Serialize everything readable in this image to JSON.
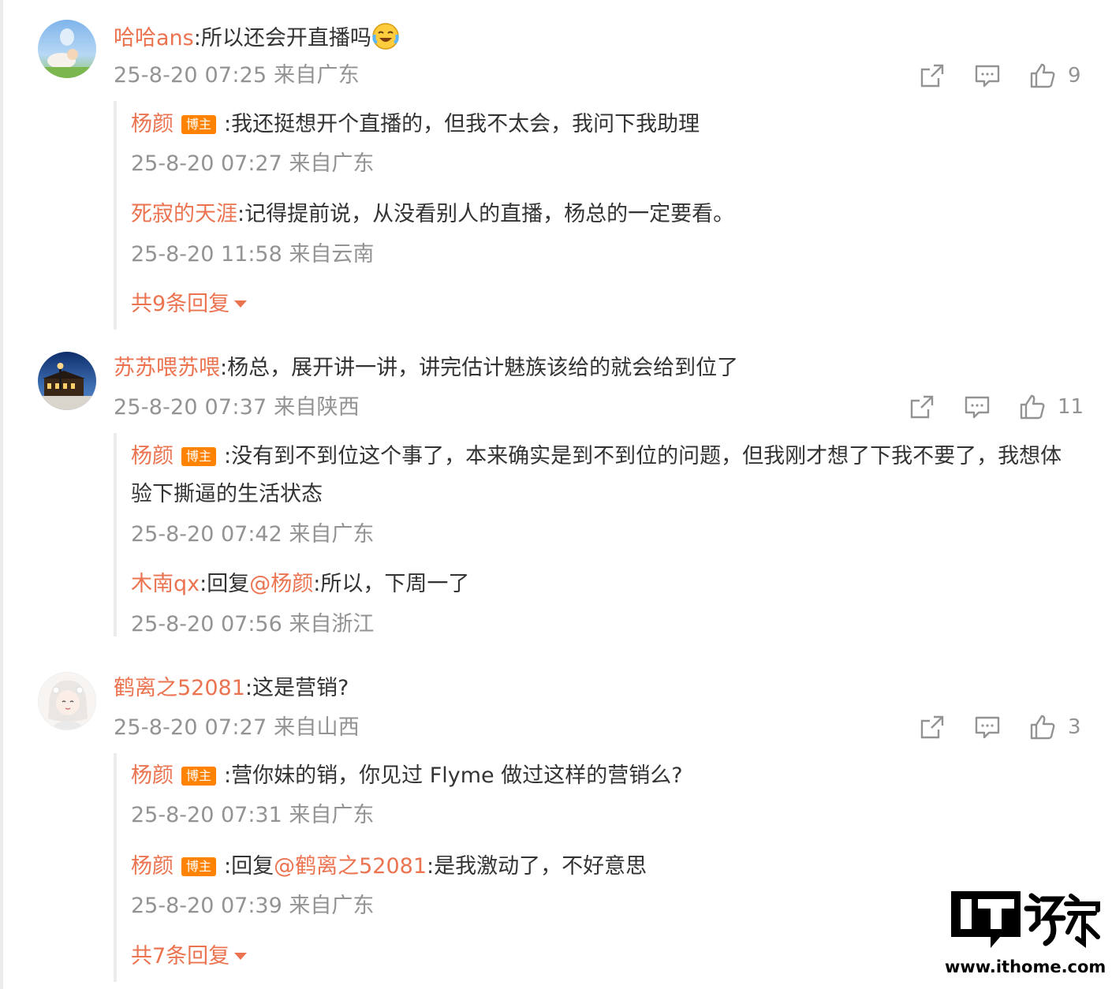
{
  "comments": [
    {
      "user": "哈哈ans",
      "text": ":所以还会开直播吗",
      "emoji": "crying-laughing-emoji",
      "meta": "25-8-20 07:25 来自广东",
      "likes": "9",
      "replies": [
        {
          "user": "杨颜",
          "badge": "博主",
          "text": ":我还挺想开个直播的，但我不太会，我问下我助理",
          "meta": "25-8-20 07:27 来自广东"
        },
        {
          "user": "死寂的天涯",
          "text": ":记得提前说，从没看别人的直播，杨总的一定要看。",
          "meta": "25-8-20 11:58 来自云南"
        }
      ],
      "more": "共9条回复"
    },
    {
      "user": "苏苏喂苏喂",
      "text": ":杨总，展开讲一讲，讲完估计魅族该给的就会给到位了",
      "meta": "25-8-20 07:37 来自陕西",
      "likes": "11",
      "replies": [
        {
          "user": "杨颜",
          "badge": "博主",
          "text": ":没有到不到位这个事了，本来确实是到不到位的问题，但我刚才想了下我不要了，我想体验下撕逼的生活状态",
          "meta": "25-8-20 07:42 来自广东"
        },
        {
          "user": "木南qx",
          "prefix": ":回复",
          "mention": "@杨颜",
          "text": ":所以，下周一了",
          "meta": "25-8-20 07:56 来自浙江"
        }
      ]
    },
    {
      "user": "鹤离之52081",
      "text": ":这是营销?",
      "meta": "25-8-20 07:27 来自山西",
      "likes": "3",
      "replies": [
        {
          "user": "杨颜",
          "badge": "博主",
          "text": ":营你妹的销，你见过 Flyme 做过这样的营销么?",
          "meta": "25-8-20 07:31 来自广东"
        },
        {
          "user": "杨颜",
          "badge": "博主",
          "prefix": ":回复",
          "mention": "@鹤离之52081",
          "text": ":是我激动了，不好意思",
          "meta": "25-8-20 07:39 来自广东"
        }
      ],
      "more": "共7条回复"
    }
  ],
  "watermark": {
    "logo_text": "IT之家",
    "url": "www.ithome.com"
  },
  "colors": {
    "name": "#eb7350",
    "meta": "#939393",
    "badge": "#ff8200",
    "text": "#333333"
  }
}
